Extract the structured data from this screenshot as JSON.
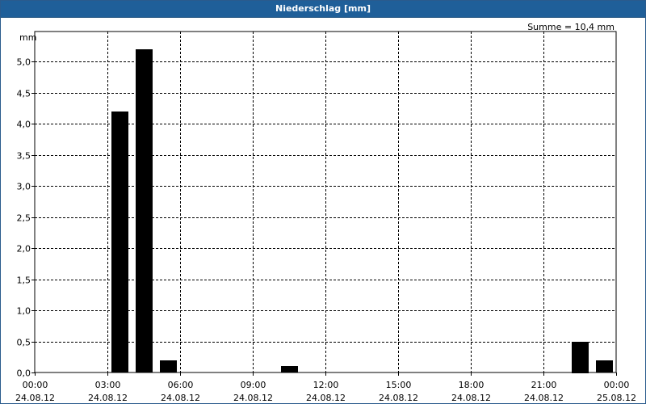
{
  "chart_data": {
    "type": "bar",
    "title": "Niederschlag [mm]",
    "ylabel": "mm",
    "sum_text": "Summe = 10,4 mm",
    "ylim": [
      0,
      5.5
    ],
    "ytick_values": [
      0,
      0.5,
      1.0,
      1.5,
      2.0,
      2.5,
      3.0,
      3.5,
      4.0,
      4.5,
      5.0
    ],
    "ytick_labels": [
      "0,0",
      "0,5",
      "1,0",
      "1,5",
      "2,0",
      "2,5",
      "3,0",
      "3,5",
      "4,0",
      "4,5",
      "5,0"
    ],
    "x_range_hours": [
      0,
      24
    ],
    "xtick_hours": [
      0,
      3,
      6,
      9,
      12,
      15,
      18,
      21,
      24
    ],
    "xtick_time_labels": [
      "00:00",
      "03:00",
      "06:00",
      "09:00",
      "12:00",
      "15:00",
      "18:00",
      "21:00",
      "00:00"
    ],
    "xtick_date_labels": [
      "24.08.12",
      "24.08.12",
      "24.08.12",
      "24.08.12",
      "24.08.12",
      "24.08.12",
      "24.08.12",
      "24.08.12",
      "25.08.12"
    ],
    "grid": true,
    "bar_color": "#000000",
    "bars": [
      {
        "hour": 3.5,
        "value": 4.2
      },
      {
        "hour": 4.5,
        "value": 5.2
      },
      {
        "hour": 5.5,
        "value": 0.2
      },
      {
        "hour": 10.5,
        "value": 0.1
      },
      {
        "hour": 22.5,
        "value": 0.5
      },
      {
        "hour": 23.5,
        "value": 0.2
      }
    ]
  }
}
